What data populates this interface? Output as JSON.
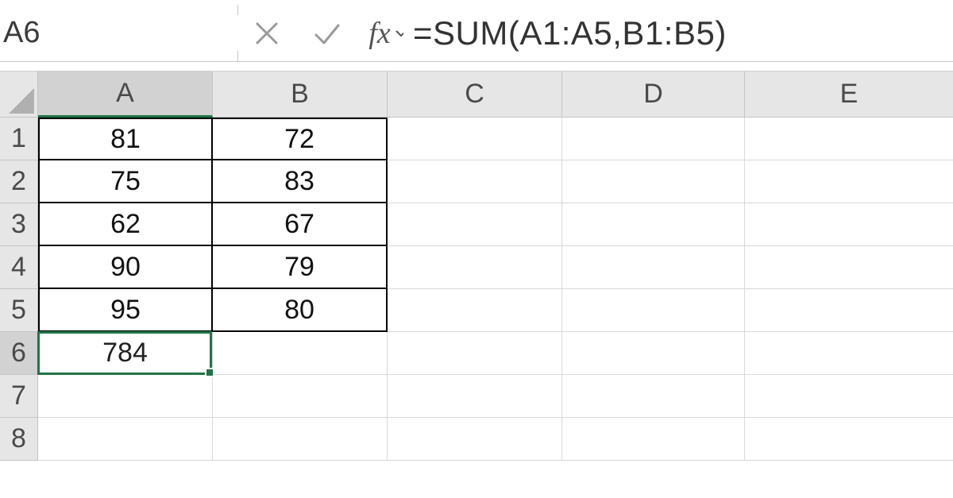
{
  "namebox": {
    "value": "A6"
  },
  "formula_bar": {
    "formula": "=SUM(A1:A5,B1:B5)",
    "fx_label": "fx"
  },
  "columns": [
    "A",
    "B",
    "C",
    "D",
    "E"
  ],
  "row_labels": [
    "1",
    "2",
    "3",
    "4",
    "5",
    "6",
    "7",
    "8"
  ],
  "active": {
    "cell": "A6",
    "row_index": 5,
    "col_index": 0
  },
  "cells": {
    "A1": "81",
    "B1": "72",
    "A2": "75",
    "B2": "83",
    "A3": "62",
    "B3": "67",
    "A4": "90",
    "B4": "79",
    "A5": "95",
    "B5": "80",
    "A6": "784"
  },
  "chart_data": {
    "type": "table",
    "columns": [
      "A",
      "B"
    ],
    "rows": [
      [
        81,
        72
      ],
      [
        75,
        83
      ],
      [
        62,
        67
      ],
      [
        90,
        79
      ],
      [
        95,
        80
      ]
    ],
    "computed": {
      "A6_sum_A1A5_B1B5": 784
    }
  }
}
